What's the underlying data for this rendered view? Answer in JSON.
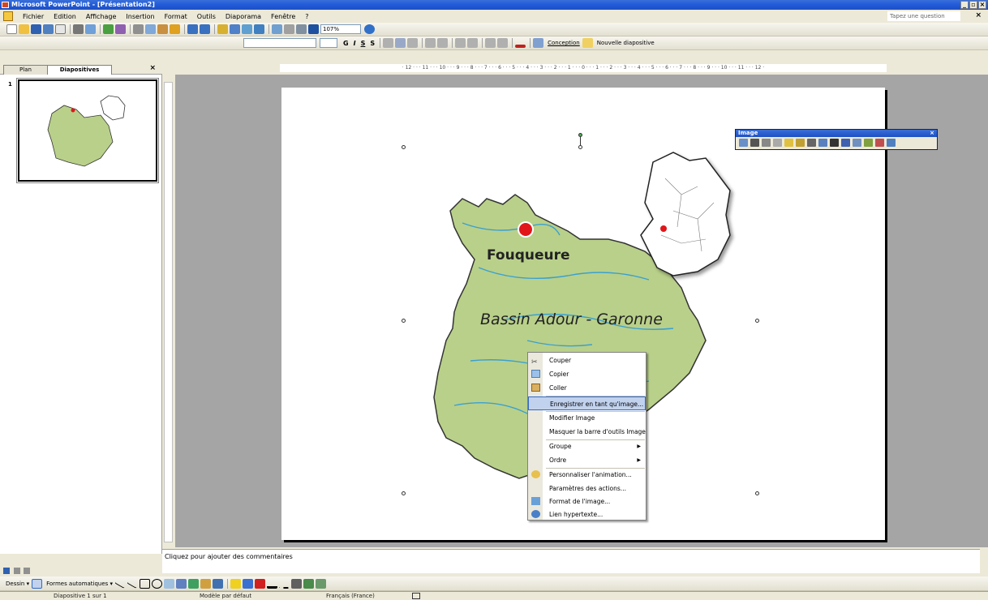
{
  "window": {
    "title": "Microsoft PowerPoint - [Présentation2]",
    "buttons": [
      "_",
      "▫",
      "×"
    ]
  },
  "menubar": {
    "items": [
      "Fichier",
      "Edition",
      "Affichage",
      "Insertion",
      "Format",
      "Outils",
      "Diaporama",
      "Fenêtre",
      "?"
    ],
    "question_placeholder": "Tapez une question",
    "close": "×"
  },
  "standard_toolbar": {
    "zoom": "107%"
  },
  "format_toolbar": {
    "font": "",
    "size": "",
    "bold": "G",
    "italic": "I",
    "underline": "S",
    "shadow": "S",
    "design": "Conception",
    "new_slide": "Nouvelle diapositive"
  },
  "left_pane": {
    "tabs": [
      "Plan",
      "Diapositives"
    ],
    "close": "×",
    "slide_number": "1"
  },
  "ruler": {
    "horizontal": "· 12 · · · 11 · · · 10 · · · 9 · · · 8 · · · 7 · · · 6 · · · 5 · · · 4 · · · 3 · · · 2 · · · 1 · · · 0 · · · 1 · · · 2 · · · 3 · · · 4 · · · 5 · · · 6 · · · 7 · · · 8 · · · 9 · · · 10 · · · 11 · · · 12 ·"
  },
  "slide": {
    "map_label_city": "Fouqueure",
    "map_label_basin": "Bassin Adour - Garonne",
    "colors": {
      "land": "#b9d08a",
      "river": "#3aa0d0",
      "marker": "#e0161b"
    }
  },
  "image_toolbar": {
    "title": "Image",
    "close": "×"
  },
  "context_menu": {
    "items": [
      {
        "label": "Couper",
        "icon": "scissors-icon"
      },
      {
        "label": "Copier",
        "icon": "copy-icon"
      },
      {
        "label": "Coller",
        "icon": "paste-icon"
      },
      {
        "label": "Enregistrer en tant qu'image...",
        "icon": ""
      },
      {
        "label": "Modifier Image",
        "icon": ""
      },
      {
        "label": "Masquer la barre d'outils Image",
        "icon": ""
      },
      {
        "label": "Groupe",
        "icon": "",
        "submenu": true
      },
      {
        "label": "Ordre",
        "icon": "",
        "submenu": true
      },
      {
        "label": "Personnaliser l'animation...",
        "icon": "animation-icon"
      },
      {
        "label": "Paramètres des actions...",
        "icon": ""
      },
      {
        "label": "Format de l'image...",
        "icon": "format-image-icon"
      },
      {
        "label": "Lien hypertexte...",
        "icon": "hyperlink-icon"
      }
    ],
    "submenu_arrow": "▶"
  },
  "notes": {
    "placeholder": "Cliquez pour ajouter des commentaires"
  },
  "drawing_toolbar": {
    "draw": "Dessin ▾",
    "autoshapes": "Formes automatiques ▾"
  },
  "status": {
    "slide": "Diapositive 1 sur 1",
    "template": "Modèle par défaut",
    "language": "Français (France)"
  }
}
